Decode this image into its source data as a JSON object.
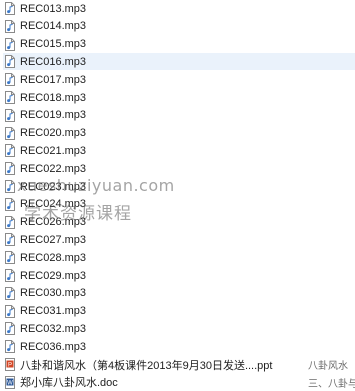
{
  "files": [
    {
      "name": "REC013.mp3",
      "type": "audio"
    },
    {
      "name": "REC014.mp3",
      "type": "audio"
    },
    {
      "name": "REC015.mp3",
      "type": "audio"
    },
    {
      "name": "REC016.mp3",
      "type": "audio",
      "selected": true
    },
    {
      "name": "REC017.mp3",
      "type": "audio"
    },
    {
      "name": "REC018.mp3",
      "type": "audio"
    },
    {
      "name": "REC019.mp3",
      "type": "audio"
    },
    {
      "name": "REC020.mp3",
      "type": "audio"
    },
    {
      "name": "REC021.mp3",
      "type": "audio"
    },
    {
      "name": "REC022.mp3",
      "type": "audio"
    },
    {
      "name": "REC023.mp3",
      "type": "audio"
    },
    {
      "name": "REC024.mp3",
      "type": "audio"
    },
    {
      "name": "REC026.mp3",
      "type": "audio"
    },
    {
      "name": "REC027.mp3",
      "type": "audio"
    },
    {
      "name": "REC028.mp3",
      "type": "audio"
    },
    {
      "name": "REC029.mp3",
      "type": "audio"
    },
    {
      "name": "REC030.mp3",
      "type": "audio"
    },
    {
      "name": "REC031.mp3",
      "type": "audio"
    },
    {
      "name": "REC032.mp3",
      "type": "audio"
    },
    {
      "name": "REC036.mp3",
      "type": "audio"
    },
    {
      "name": "八卦和谐风水（第4板课件2013年9月30日发送....ppt",
      "type": "ppt",
      "col2": "八卦风水"
    },
    {
      "name": "郑小库八卦风水.doc",
      "type": "doc",
      "col2": "三、八卦与"
    }
  ],
  "watermark": {
    "line1": "xueshuziyuan.com",
    "line2": "学术资源课程"
  },
  "colors": {
    "selected_row": "#eaf2fb",
    "audio_icon": "#3a78c9",
    "ppt_icon": "#d24726",
    "doc_icon": "#2b5797"
  }
}
